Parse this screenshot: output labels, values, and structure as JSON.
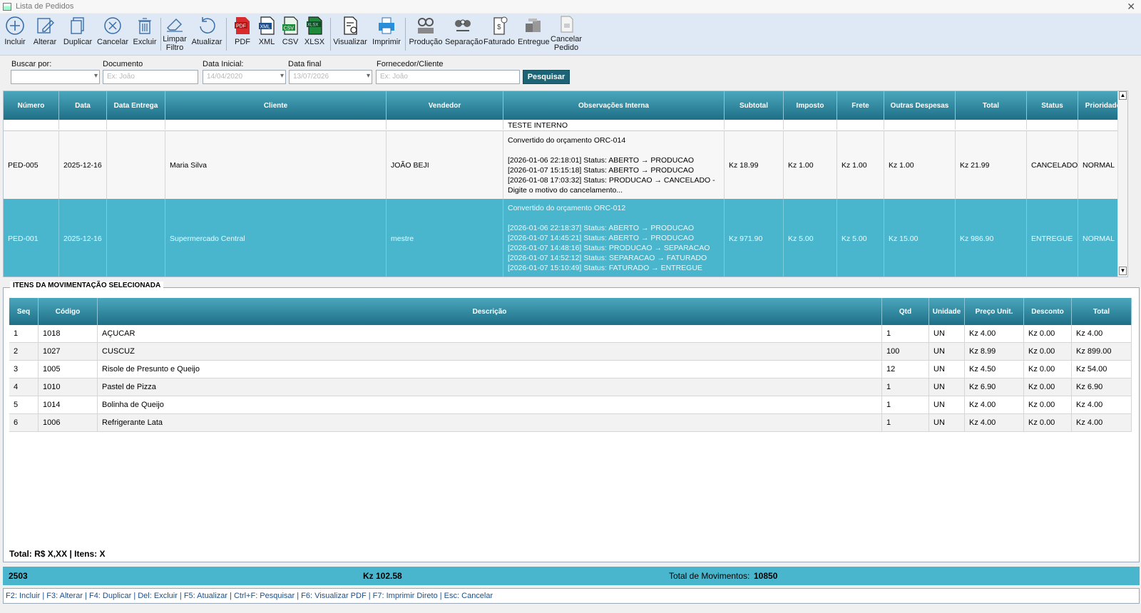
{
  "window": {
    "title": "Lista de Pedidos"
  },
  "toolbar": {
    "incluir": "Incluir",
    "alterar": "Alterar",
    "duplicar": "Duplicar",
    "cancelar": "Cancelar",
    "excluir": "Excluir",
    "limpar1": "Limpar",
    "limpar2": "Filtro",
    "atualizar": "Atualizar",
    "pdf": "PDF",
    "xml": "XML",
    "csv": "CSV",
    "xlsx": "XLSX",
    "visualizar": "Visualizar",
    "imprimir": "Imprimir",
    "producao": "Produção",
    "separacao": "Separação",
    "faturado": "Faturado",
    "entregue": "Entregue",
    "cancelar_pedido1": "Cancelar",
    "cancelar_pedido2": "Pedido"
  },
  "filters": {
    "buscar_label": "Buscar por:",
    "buscar_value": "",
    "documento_label": "Documento",
    "documento_placeholder": "Ex: João",
    "data_inicial_label": "Data Inicial:",
    "data_inicial_value": "14/04/2020",
    "data_final_label": "Data final",
    "data_final_value": "13/07/2026",
    "fornecedor_label": "Fornecedor/Cliente",
    "fornecedor_placeholder": "Ex: João",
    "pesquisar": "Pesquisar"
  },
  "orders": {
    "columns": [
      "Número",
      "Data",
      "Data Entrega",
      "Cliente",
      "Vendedor",
      "Observações Interna",
      "Subtotal",
      "Imposto",
      "Frete",
      "Outras Despesas",
      "Total",
      "Status",
      "Prioridade"
    ],
    "partial_row_obs": "TESTE INTERNO",
    "rows": [
      {
        "numero": "PED-005",
        "data": "2025-12-16",
        "data_entrega": "",
        "cliente": "Maria Silva",
        "vendedor": "JOÃO BEJI",
        "obs": [
          "Convertido do orçamento ORC-014",
          "",
          "[2026-01-06 22:18:01] Status: ABERTO → PRODUCAO",
          "[2026-01-07 15:15:18] Status: ABERTO → PRODUCAO",
          "[2026-01-08 17:03:32] Status: PRODUCAO → CANCELADO -",
          "Digite o motivo do cancelamento..."
        ],
        "subtotal": "Kz 18.99",
        "imposto": "Kz 1.00",
        "frete": "Kz 1.00",
        "outras": "Kz 1.00",
        "total": "Kz 21.99",
        "status": "CANCELADO",
        "prioridade": "NORMAL"
      },
      {
        "numero": "PED-001",
        "data": "2025-12-16",
        "data_entrega": "",
        "cliente": "Supermercado Central",
        "vendedor": "mestre",
        "obs": [
          "Convertido do orçamento ORC-012",
          "",
          "[2026-01-06 22:18:37] Status: ABERTO → PRODUCAO",
          "[2026-01-07 14:45:21] Status: ABERTO → PRODUCAO",
          "[2026-01-07 14:48:16] Status: PRODUCAO → SEPARACAO",
          "[2026-01-07 14:52:12] Status: SEPARACAO → FATURADO",
          "[2026-01-07 15:10:49] Status: FATURADO → ENTREGUE"
        ],
        "subtotal": "Kz 971.90",
        "imposto": "Kz 5.00",
        "frete": "Kz 5.00",
        "outras": "Kz 15.00",
        "total": "Kz 986.90",
        "status": "ENTREGUE",
        "prioridade": "NORMAL"
      }
    ]
  },
  "items": {
    "legend": "ITENS DA MOVIMENTAÇÃO SELECIONADA",
    "columns": [
      "Seq",
      "Código",
      "Descrição",
      "Qtd",
      "Unidade",
      "Preço Unit.",
      "Desconto",
      "Total"
    ],
    "rows": [
      [
        "1",
        "1018",
        "AÇUCAR",
        "1",
        "UN",
        "Kz 4.00",
        "Kz 0.00",
        "Kz 4.00"
      ],
      [
        "2",
        "1027",
        "CUSCUZ",
        "100",
        "UN",
        "Kz 8.99",
        "Kz 0.00",
        "Kz 899.00"
      ],
      [
        "3",
        "1005",
        "Risole de Presunto e Queijo",
        "12",
        "UN",
        "Kz 4.50",
        "Kz 0.00",
        "Kz 54.00"
      ],
      [
        "4",
        "1010",
        "Pastel de Pizza",
        "1",
        "UN",
        "Kz 6.90",
        "Kz 0.00",
        "Kz 6.90"
      ],
      [
        "5",
        "1014",
        "Bolinha de Queijo",
        "1",
        "UN",
        "Kz 4.00",
        "Kz 0.00",
        "Kz 4.00"
      ],
      [
        "6",
        "1006",
        "Refrigerante Lata",
        "1",
        "UN",
        "Kz 4.00",
        "Kz 0.00",
        "Kz 4.00"
      ]
    ],
    "total_text": "Total: R$ X,XX | Itens: X"
  },
  "status": {
    "count": "2503",
    "amount": "Kz 102.58",
    "movimentos_label": "Total de Movimentos:",
    "movimentos_value": "10850"
  },
  "shortcuts": "F2: Incluir | F3: Alterar | F4: Duplicar | Del: Excluir | F5: Atualizar | Ctrl+F: Pesquisar | F6: Visualizar PDF | F7: Imprimir Direto |  Esc: Cancelar",
  "colors": {
    "header": "#1e6f86",
    "selected": "#4ab6ce",
    "toolbar": "#dfe9f5",
    "button": "#1e6477",
    "shortcut_text": "#1d4e89"
  }
}
